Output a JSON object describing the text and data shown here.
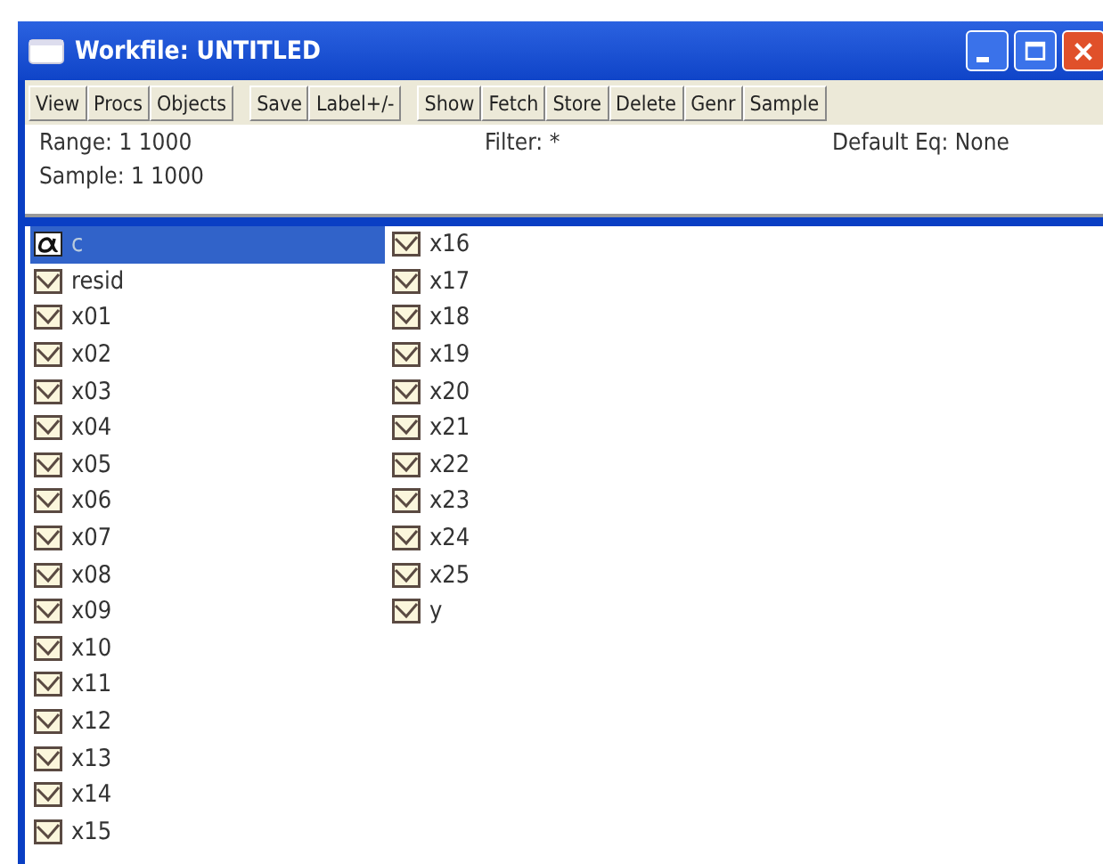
{
  "window": {
    "title": "Workfile: UNTITLED"
  },
  "toolbar": [
    [
      "View",
      "Procs",
      "Objects"
    ],
    [
      "Save",
      "Label+/-"
    ],
    [
      "Show",
      "Fetch",
      "Store",
      "Delete",
      "Genr",
      "Sample"
    ]
  ],
  "info": {
    "range_label": "Range:",
    "range_value": "1 1000",
    "filter_label": "Filter:",
    "filter_value": "*",
    "default_eq_label": "Default Eq:",
    "default_eq_value": "None",
    "sample_label": "Sample:",
    "sample_value": "1 1000"
  },
  "objects": [
    {
      "name": "c",
      "kind": "coef",
      "selected": true
    },
    {
      "name": "resid",
      "kind": "series",
      "selected": false
    },
    {
      "name": "x01",
      "kind": "series",
      "selected": false
    },
    {
      "name": "x02",
      "kind": "series",
      "selected": false
    },
    {
      "name": "x03",
      "kind": "series",
      "selected": false
    },
    {
      "name": "x04",
      "kind": "series",
      "selected": false
    },
    {
      "name": "x05",
      "kind": "series",
      "selected": false
    },
    {
      "name": "x06",
      "kind": "series",
      "selected": false
    },
    {
      "name": "x07",
      "kind": "series",
      "selected": false
    },
    {
      "name": "x08",
      "kind": "series",
      "selected": false
    },
    {
      "name": "x09",
      "kind": "series",
      "selected": false
    },
    {
      "name": "x10",
      "kind": "series",
      "selected": false
    },
    {
      "name": "x11",
      "kind": "series",
      "selected": false
    },
    {
      "name": "x12",
      "kind": "series",
      "selected": false
    },
    {
      "name": "x13",
      "kind": "series",
      "selected": false
    },
    {
      "name": "x14",
      "kind": "series",
      "selected": false
    },
    {
      "name": "x15",
      "kind": "series",
      "selected": false
    },
    {
      "name": "x16",
      "kind": "series",
      "selected": false
    },
    {
      "name": "x17",
      "kind": "series",
      "selected": false
    },
    {
      "name": "x18",
      "kind": "series",
      "selected": false
    },
    {
      "name": "x19",
      "kind": "series",
      "selected": false
    },
    {
      "name": "x20",
      "kind": "series",
      "selected": false
    },
    {
      "name": "x21",
      "kind": "series",
      "selected": false
    },
    {
      "name": "x22",
      "kind": "series",
      "selected": false
    },
    {
      "name": "x23",
      "kind": "series",
      "selected": false
    },
    {
      "name": "x24",
      "kind": "series",
      "selected": false
    },
    {
      "name": "x25",
      "kind": "series",
      "selected": false
    },
    {
      "name": "y",
      "kind": "series",
      "selected": false
    }
  ]
}
